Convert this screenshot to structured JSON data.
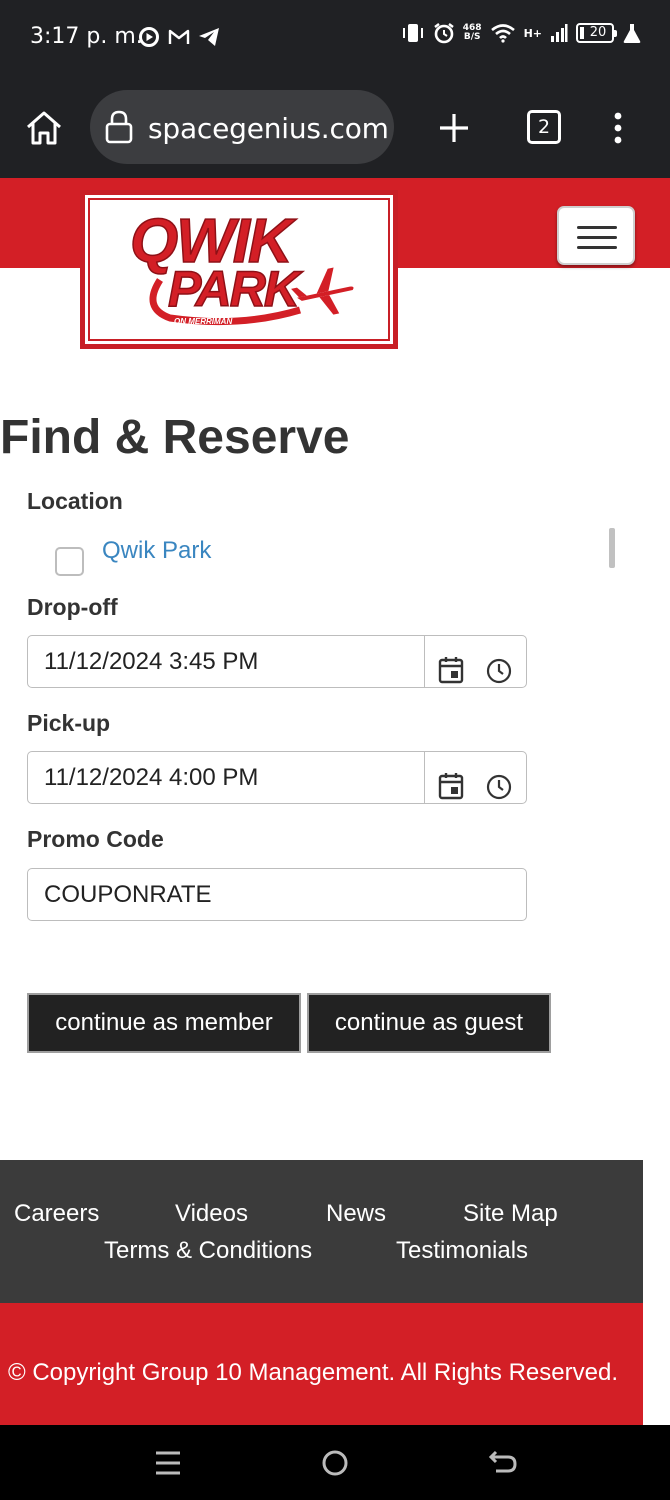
{
  "status_bar": {
    "time": "3:17 p. m.",
    "net_speed_value": "468",
    "net_speed_unit": "B/S",
    "network_type": "H+",
    "battery_level": "20"
  },
  "browser": {
    "url": "spacegenius.com",
    "tab_count": "2"
  },
  "brand": {
    "logo_line1": "QWIK",
    "logo_line2": "PARK",
    "logo_tagline": "ON MERRIMAN",
    "primary_color": "#d31f26",
    "dark_color": "#3b3b3b"
  },
  "main": {
    "title": "Find & Reserve",
    "location_label": "Location",
    "location_option": "Qwik Park",
    "dropoff_label": "Drop-off",
    "dropoff_value": "11/12/2024 3:45 PM",
    "pickup_label": "Pick-up",
    "pickup_value": "11/12/2024 4:00 PM",
    "promo_label": "Promo Code",
    "promo_value": "COUPONRATE",
    "member_button": "continue as member",
    "guest_button": "continue as guest"
  },
  "footer": {
    "links": [
      "Careers",
      "Videos",
      "News",
      "Site Map",
      "Terms & Conditions",
      "Testimonials"
    ],
    "copyright": "© Copyright Group 10 Management. All Rights Reserved."
  }
}
